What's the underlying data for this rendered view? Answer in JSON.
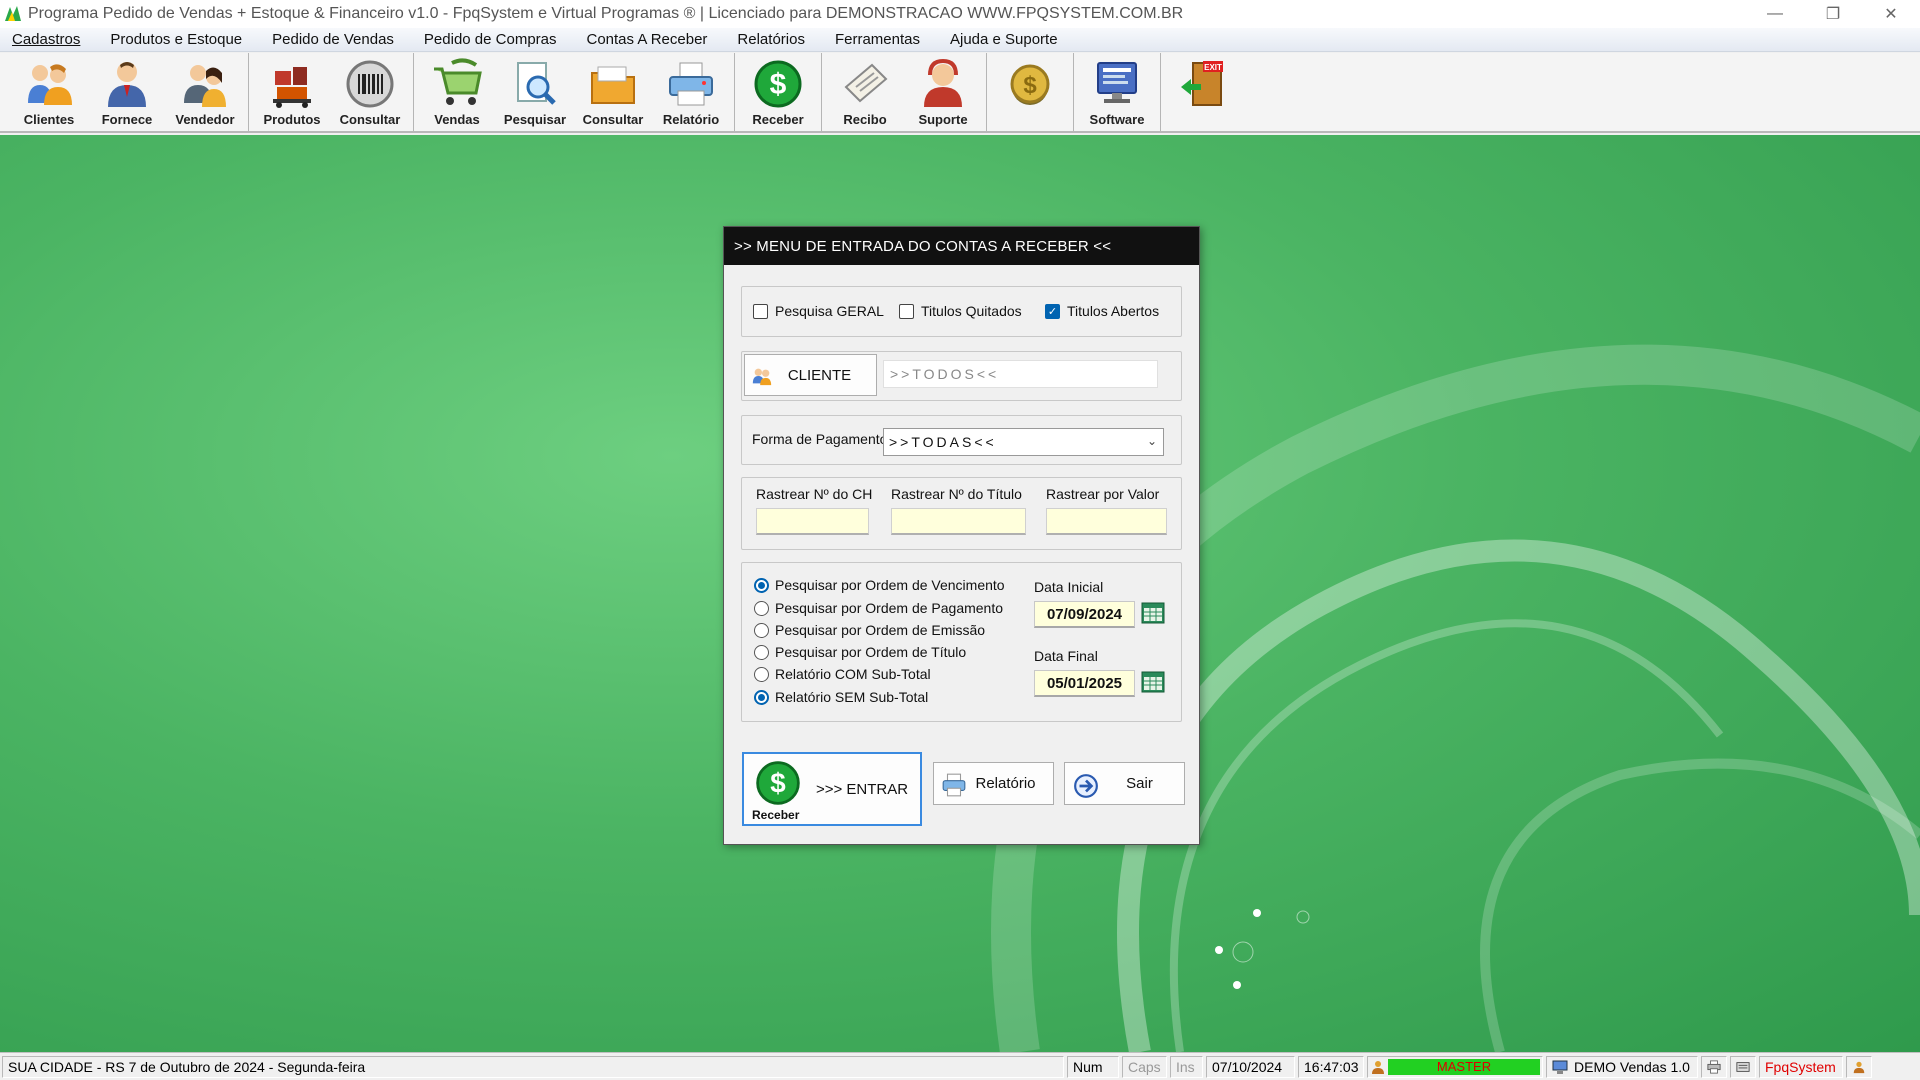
{
  "window": {
    "title": "Programa Pedido de Vendas + Estoque & Financeiro v1.0 - FpqSystem e Virtual Programas ® | Licenciado para  DEMONSTRACAO WWW.FPQSYSTEM.COM.BR"
  },
  "menu": [
    "Cadastros",
    "Produtos e Estoque",
    "Pedido de Vendas",
    "Pedido de Compras",
    "Contas A Receber",
    "Relatórios",
    "Ferramentas",
    "Ajuda e Suporte"
  ],
  "toolbar": {
    "clientes": "Clientes",
    "fornece": "Fornece",
    "vendedor": "Vendedor",
    "produtos": "Produtos",
    "consultar1": "Consultar",
    "vendas": "Vendas",
    "pesquisar": "Pesquisar",
    "consultar2": "Consultar",
    "relatorio": "Relatório",
    "receber": "Receber",
    "recibo": "Recibo",
    "suporte": "Suporte",
    "software": "Software",
    "exit": "EXIT"
  },
  "dialog": {
    "title": ">>  MENU DE ENTRADA DO CONTAS A RECEBER  <<",
    "chk_geral": "Pesquisa GERAL",
    "chk_geral_checked": false,
    "chk_quitados": "Titulos Quitados",
    "chk_quitados_checked": false,
    "chk_abertos": "Titulos Abertos",
    "chk_abertos_checked": true,
    "cliente_button": "CLIENTE",
    "cliente_value": ">>TODOS<<",
    "forma_label": "Forma de Pagamento",
    "forma_value": ">>TODAS<<",
    "rastrear_ch": "Rastrear Nº do CH",
    "rastrear_titulo": "Rastrear Nº do Título",
    "rastrear_valor": "Rastrear por Valor",
    "radios": [
      {
        "label": "Pesquisar por Ordem de Vencimento",
        "checked": true
      },
      {
        "label": "Pesquisar por Ordem de Pagamento",
        "checked": false
      },
      {
        "label": "Pesquisar por Ordem de Emissão",
        "checked": false
      },
      {
        "label": "Pesquisar por Ordem de Título",
        "checked": false
      },
      {
        "label": "Relatório COM Sub-Total",
        "checked": false
      },
      {
        "label": "Relatório SEM Sub-Total",
        "checked": true
      }
    ],
    "data_inicial_label": "Data Inicial",
    "data_inicial": "07/09/2024",
    "data_final_label": "Data Final",
    "data_final": "05/01/2025",
    "receber_caption": "Receber",
    "entrar_label": ">>> ENTRAR",
    "relatorio_label": "Relatório",
    "sair_label": "Sair"
  },
  "statusbar": {
    "location": "SUA CIDADE - RS  7 de Outubro de 2024 - Segunda-feira",
    "num": "Num",
    "caps": "Caps",
    "ins": "Ins",
    "date": "07/10/2024",
    "time": "16:47:03",
    "user": "MASTER",
    "demo": "DEMO Vendas 1.0",
    "brand": "FpqSystem"
  },
  "colors": {
    "accent": "#0063b1",
    "desktop_green": "#4bb463",
    "master_green": "#22d022",
    "brand_red": "#e00000"
  }
}
